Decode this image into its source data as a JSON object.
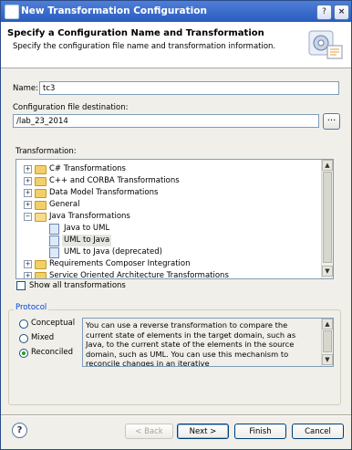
{
  "window": {
    "title": "New Transformation Configuration",
    "controls": [
      "?",
      "×"
    ]
  },
  "header": {
    "title": "Specify a Configuration Name and Transformation",
    "subtitle": "Specify the configuration file name and transformation information."
  },
  "form": {
    "name_label": "Name:",
    "name_value": "tc3",
    "destination_label": "Configuration file destination:",
    "destination_value": "/lab_23_2014",
    "browse_label": "..."
  },
  "transformation": {
    "label": "Transformation:",
    "items": [
      {
        "label": "C# Transformations",
        "expander": "+",
        "icon": "folder-icon"
      },
      {
        "label": "C++ and CORBA Transformations",
        "expander": "+",
        "icon": "folder-icon"
      },
      {
        "label": "Data Model Transformations",
        "expander": "+",
        "icon": "folder-icon"
      },
      {
        "label": "General",
        "expander": "+",
        "icon": "folder-icon"
      },
      {
        "label": "Java Transformations",
        "expander": "−",
        "icon": "folder-open-icon"
      },
      {
        "label": "Java to UML",
        "icon": "transform-icon"
      },
      {
        "label": "UML to Java",
        "icon": "transform-icon",
        "selected": true
      },
      {
        "label": "UML to Java (deprecated)",
        "icon": "transform-icon"
      },
      {
        "label": "Requirements Composer Integration",
        "expander": "+",
        "icon": "folder-icon"
      },
      {
        "label": "Service Oriented Architecture Transformations",
        "expander": "+",
        "icon": "folder-icon"
      }
    ],
    "show_all_label": "Show all transformations",
    "show_all_checked": false
  },
  "protocol": {
    "title": "Protocol",
    "options": [
      "Conceptual",
      "Mixed",
      "Reconciled"
    ],
    "selected": "Reconciled",
    "description": "You can use a reverse transformation to compare the current state of elements in the target domain, such as Java, to the current state of the elements in the source domain, such as UML. You can use this mechanism to reconcile changes in an iterative"
  },
  "footer": {
    "help_label": "?",
    "back_label": "< Back",
    "next_label": "Next >",
    "finish_label": "Finish",
    "cancel_label": "Cancel"
  }
}
